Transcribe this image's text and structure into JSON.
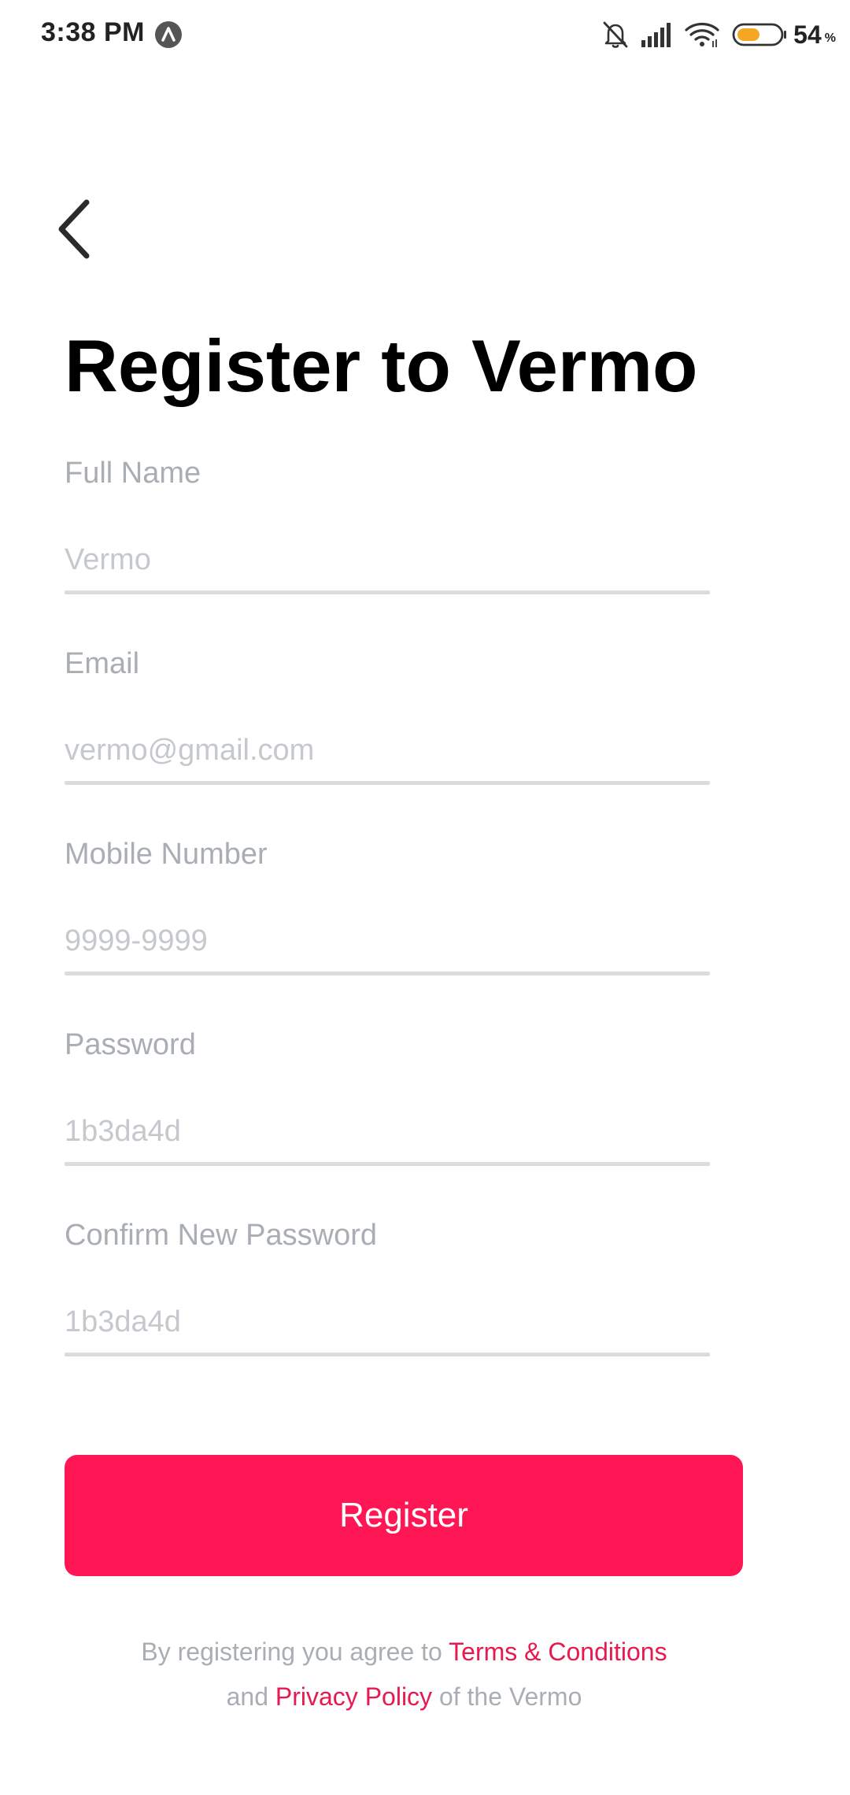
{
  "status_bar": {
    "time": "3:38 PM",
    "battery_percent": "54",
    "battery_unit": "%",
    "battery_level": 0.54,
    "icons": [
      "app-notification-icon",
      "mute-icon",
      "signal-icon",
      "wifi-icon",
      "battery-icon"
    ]
  },
  "colors": {
    "accent": "#ff1654",
    "link": "#e8194f",
    "label": "#a9aeb5",
    "placeholder": "#c5c8cc",
    "underline": "#dcdcdc",
    "battery_fill": "#f5a623"
  },
  "header": {
    "back_icon": "chevron-left-icon",
    "title": "Register to Vermo"
  },
  "form": {
    "fields": [
      {
        "label": "Full Name",
        "placeholder": "Vermo",
        "value": ""
      },
      {
        "label": "Email",
        "placeholder": "vermo@gmail.com",
        "value": ""
      },
      {
        "label": "Mobile Number",
        "placeholder": "9999-9999",
        "value": ""
      },
      {
        "label": "Password",
        "placeholder": "1b3da4d",
        "value": ""
      },
      {
        "label": "Confirm New Password",
        "placeholder": "1b3da4d",
        "value": ""
      }
    ],
    "submit_label": "Register"
  },
  "legal": {
    "prefix": "By registering you agree to ",
    "terms_link": "Terms & Conditions",
    "middle": "and ",
    "privacy_link": "Privacy Policy",
    "suffix": " of the Vermo"
  }
}
